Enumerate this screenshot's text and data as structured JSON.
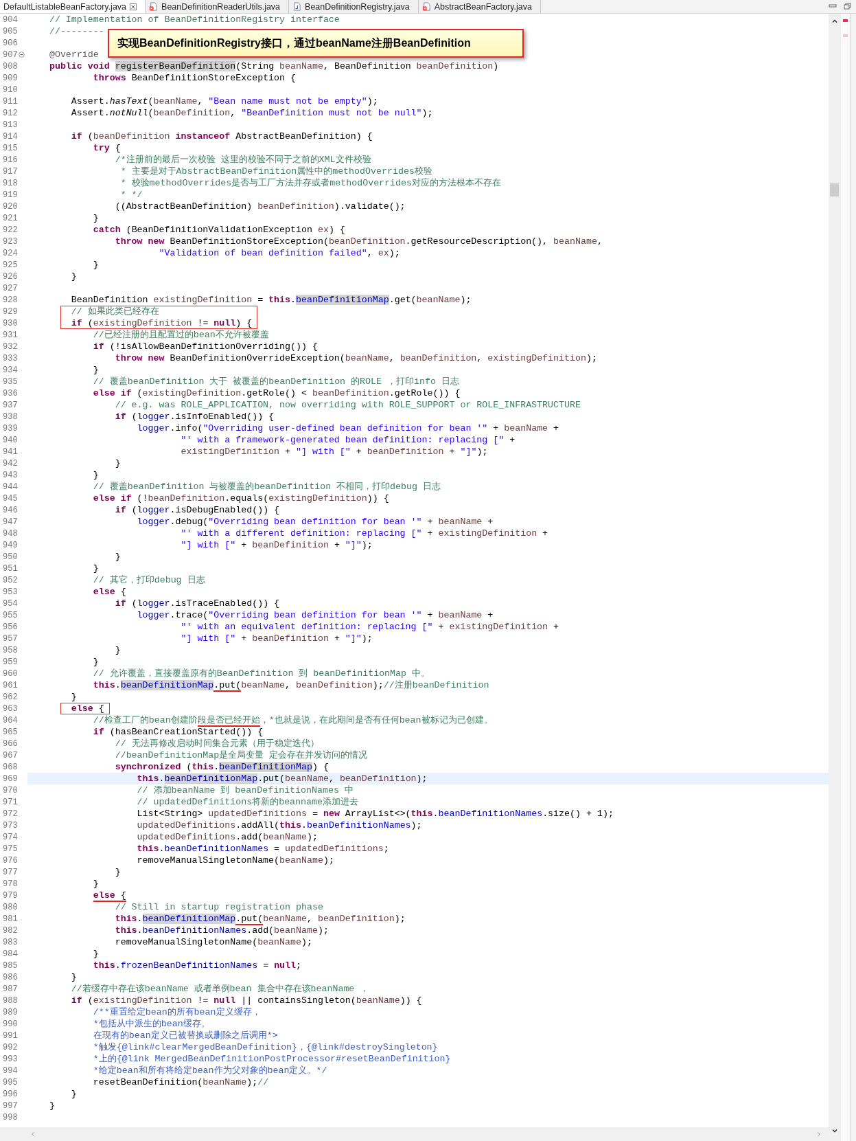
{
  "tabs": [
    {
      "label": "DefaultListableBeanFactory.java",
      "selected": true,
      "kind": "plain"
    },
    {
      "label": "BeanDefinitionReaderUtils.java",
      "selected": false,
      "kind": "error-file"
    },
    {
      "label": "BeanDefinitionRegistry.java",
      "selected": false,
      "kind": "java-file"
    },
    {
      "label": "AbstractBeanFactory.java",
      "selected": false,
      "kind": "error-file"
    }
  ],
  "callout": {
    "text": "实现BeanDefinitionRegistry接口，通过beanName注册BeanDefinition"
  },
  "lines": [
    {
      "number": "904",
      "code": [
        {
          "kind": "comment",
          "text": "    // Implementation of BeanDefinitionRegistry interface"
        }
      ]
    },
    {
      "number": "905",
      "code": [
        {
          "kind": "comment",
          "text": "    //--------"
        }
      ]
    },
    {
      "number": "906"
    },
    {
      "number": "907",
      "foldable": true,
      "code": [
        {
          "kind": "annotation",
          "text": "    @Override"
        }
      ]
    },
    {
      "number": "908",
      "code": [
        {
          "kind": "keyword",
          "text": "    public void "
        },
        {
          "kind": "method",
          "text": "registerBeanDefinition"
        },
        {
          "kind": "plain",
          "text": "(String "
        },
        {
          "kind": "local",
          "text": "beanName"
        },
        {
          "kind": "plain",
          "text": ", BeanDefinition "
        },
        {
          "kind": "local",
          "text": "beanDefinition"
        },
        {
          "kind": "plain",
          "text": ")"
        }
      ]
    },
    {
      "number": "909",
      "code": [
        {
          "kind": "keyword",
          "text": "            throws "
        },
        {
          "kind": "plain",
          "text": "BeanDefinitionStoreException {"
        }
      ]
    },
    {
      "number": "910"
    },
    {
      "number": "911",
      "code": [
        {
          "kind": "plain",
          "text": "        Assert."
        },
        {
          "kind": "italic",
          "text": "hasText"
        },
        {
          "kind": "plain",
          "text": "("
        },
        {
          "kind": "local",
          "text": "beanName"
        },
        {
          "kind": "plain",
          "text": ", "
        },
        {
          "kind": "string",
          "text": "\"Bean name must not be empty\""
        },
        {
          "kind": "plain",
          "text": ");"
        }
      ]
    },
    {
      "number": "912",
      "code": [
        {
          "kind": "plain",
          "text": "        Assert."
        },
        {
          "kind": "italic",
          "text": "notNull"
        },
        {
          "kind": "plain",
          "text": "("
        },
        {
          "kind": "local",
          "text": "beanDefinition"
        },
        {
          "kind": "plain",
          "text": ", "
        },
        {
          "kind": "string",
          "text": "\"BeanDefinition must not be null\""
        },
        {
          "kind": "plain",
          "text": ");"
        }
      ]
    },
    {
      "number": "913"
    },
    {
      "number": "914",
      "code": [
        {
          "kind": "keyword",
          "text": "        if "
        },
        {
          "kind": "plain",
          "text": "("
        },
        {
          "kind": "local",
          "text": "beanDefinition"
        },
        {
          "kind": "keyword",
          "text": " instanceof "
        },
        {
          "kind": "plain",
          "text": "AbstractBeanDefinition) {"
        }
      ]
    },
    {
      "number": "915",
      "code": [
        {
          "kind": "keyword",
          "text": "            try "
        },
        {
          "kind": "plain",
          "text": "{"
        }
      ]
    },
    {
      "number": "916",
      "code": [
        {
          "kind": "comment",
          "text": "                /*注册前的最后一次校验 这里的校验不同于之前的XML文件校验"
        }
      ]
    },
    {
      "number": "917",
      "code": [
        {
          "kind": "comment",
          "text": "                 * 主要是对于AbstractBeanDefinition属性中的methodOverrides校验"
        }
      ]
    },
    {
      "number": "918",
      "code": [
        {
          "kind": "comment",
          "text": "                 * 校验methodOverrides是否与工厂方法并存或者methodOverrides对应的方法根本不存在"
        }
      ]
    },
    {
      "number": "919",
      "code": [
        {
          "kind": "comment",
          "text": "                 * */"
        }
      ]
    },
    {
      "number": "920",
      "code": [
        {
          "kind": "plain",
          "text": "                ((AbstractBeanDefinition) "
        },
        {
          "kind": "local",
          "text": "beanDefinition"
        },
        {
          "kind": "plain",
          "text": ").validate();"
        }
      ]
    },
    {
      "number": "921",
      "code": [
        {
          "kind": "plain",
          "text": "            }"
        }
      ]
    },
    {
      "number": "922",
      "code": [
        {
          "kind": "keyword",
          "text": "            catch "
        },
        {
          "kind": "plain",
          "text": "(BeanDefinitionValidationException "
        },
        {
          "kind": "local",
          "text": "ex"
        },
        {
          "kind": "plain",
          "text": ") {"
        }
      ]
    },
    {
      "number": "923",
      "code": [
        {
          "kind": "keyword",
          "text": "                throw new "
        },
        {
          "kind": "plain",
          "text": "BeanDefinitionStoreException("
        },
        {
          "kind": "local",
          "text": "beanDefinition"
        },
        {
          "kind": "plain",
          "text": ".getResourceDescription(), "
        },
        {
          "kind": "local",
          "text": "beanName"
        },
        {
          "kind": "plain",
          "text": ","
        }
      ]
    },
    {
      "number": "924",
      "code": [
        {
          "kind": "string",
          "text": "                        \"Validation of bean definition failed\""
        },
        {
          "kind": "plain",
          "text": ", "
        },
        {
          "kind": "local",
          "text": "ex"
        },
        {
          "kind": "plain",
          "text": ");"
        }
      ]
    },
    {
      "number": "925",
      "code": [
        {
          "kind": "plain",
          "text": "            }"
        }
      ]
    },
    {
      "number": "926",
      "code": [
        {
          "kind": "plain",
          "text": "        }"
        }
      ]
    },
    {
      "number": "927"
    },
    {
      "number": "928",
      "code": [
        {
          "kind": "plain",
          "text": "        BeanDefinition "
        },
        {
          "kind": "local",
          "text": "existingDefinition"
        },
        {
          "kind": "plain",
          "text": " = "
        },
        {
          "kind": "keyword",
          "text": "this"
        },
        {
          "kind": "plain",
          "text": "."
        },
        {
          "kind": "marked-field",
          "text": "beanDefinitionMap"
        },
        {
          "kind": "plain",
          "text": ".get("
        },
        {
          "kind": "local",
          "text": "beanName"
        },
        {
          "kind": "plain",
          "text": ");"
        }
      ]
    },
    {
      "number": "929",
      "boxed": true,
      "code": [
        {
          "kind": "comment",
          "text": "        // 如果此类已经存在"
        }
      ]
    },
    {
      "number": "930",
      "boxed": true,
      "code": [
        {
          "kind": "keyword",
          "text": "        if "
        },
        {
          "kind": "plain",
          "text": "("
        },
        {
          "kind": "local",
          "text": "existingDefinition"
        },
        {
          "kind": "plain",
          "text": " != "
        },
        {
          "kind": "keyword",
          "text": "null"
        },
        {
          "kind": "plain",
          "text": ") {"
        }
      ]
    },
    {
      "number": "931",
      "code": [
        {
          "kind": "comment",
          "text": "            //已经注册的且配置过的bean不允许被覆盖"
        }
      ]
    },
    {
      "number": "932",
      "code": [
        {
          "kind": "keyword",
          "text": "            if "
        },
        {
          "kind": "plain",
          "text": "(!isAllowBeanDefinitionOverriding()) {"
        }
      ]
    },
    {
      "number": "933",
      "code": [
        {
          "kind": "keyword",
          "text": "                throw new "
        },
        {
          "kind": "plain",
          "text": "BeanDefinitionOverrideException("
        },
        {
          "kind": "local",
          "text": "beanName"
        },
        {
          "kind": "plain",
          "text": ", "
        },
        {
          "kind": "local",
          "text": "beanDefinition"
        },
        {
          "kind": "plain",
          "text": ", "
        },
        {
          "kind": "local",
          "text": "existingDefinition"
        },
        {
          "kind": "plain",
          "text": ");"
        }
      ]
    },
    {
      "number": "934",
      "code": [
        {
          "kind": "plain",
          "text": "            }"
        }
      ]
    },
    {
      "number": "935",
      "code": [
        {
          "kind": "comment",
          "text": "            // 覆盖beanDefinition 大于 被覆盖的beanDefinition 的ROLE ，打印info 日志"
        }
      ]
    },
    {
      "number": "936",
      "code": [
        {
          "kind": "keyword",
          "text": "            else if "
        },
        {
          "kind": "plain",
          "text": "("
        },
        {
          "kind": "local",
          "text": "existingDefinition"
        },
        {
          "kind": "plain",
          "text": ".getRole() < "
        },
        {
          "kind": "local",
          "text": "beanDefinition"
        },
        {
          "kind": "plain",
          "text": ".getRole()) {"
        }
      ]
    },
    {
      "number": "937",
      "code": [
        {
          "kind": "comment",
          "text": "                // e.g. was ROLE_APPLICATION, now overriding with ROLE_SUPPORT or ROLE_INFRASTRUCTURE"
        }
      ]
    },
    {
      "number": "938",
      "code": [
        {
          "kind": "keyword",
          "text": "                if "
        },
        {
          "kind": "plain",
          "text": "("
        },
        {
          "kind": "field",
          "text": "logger"
        },
        {
          "kind": "plain",
          "text": ".isInfoEnabled()) {"
        }
      ]
    },
    {
      "number": "939",
      "code": [
        {
          "kind": "field",
          "text": "                    logger"
        },
        {
          "kind": "plain",
          "text": ".info("
        },
        {
          "kind": "string",
          "text": "\"Overriding user-defined bean definition for bean '\""
        },
        {
          "kind": "plain",
          "text": " + "
        },
        {
          "kind": "local",
          "text": "beanName"
        },
        {
          "kind": "plain",
          "text": " +"
        }
      ]
    },
    {
      "number": "940",
      "code": [
        {
          "kind": "string",
          "text": "                            \"' with a framework-generated bean definition: replacing [\""
        },
        {
          "kind": "plain",
          "text": " +"
        }
      ]
    },
    {
      "number": "941",
      "code": [
        {
          "kind": "local",
          "text": "                            existingDefinition"
        },
        {
          "kind": "plain",
          "text": " + "
        },
        {
          "kind": "string",
          "text": "\"] with [\""
        },
        {
          "kind": "plain",
          "text": " + "
        },
        {
          "kind": "local",
          "text": "beanDefinition"
        },
        {
          "kind": "plain",
          "text": " + "
        },
        {
          "kind": "string",
          "text": "\"]\""
        },
        {
          "kind": "plain",
          "text": ");"
        }
      ]
    },
    {
      "number": "942",
      "code": [
        {
          "kind": "plain",
          "text": "                }"
        }
      ]
    },
    {
      "number": "943",
      "code": [
        {
          "kind": "plain",
          "text": "            }"
        }
      ]
    },
    {
      "number": "944",
      "code": [
        {
          "kind": "comment",
          "text": "            // 覆盖beanDefinition 与被覆盖的beanDefinition 不相同，打印debug 日志"
        }
      ]
    },
    {
      "number": "945",
      "code": [
        {
          "kind": "keyword",
          "text": "            else if "
        },
        {
          "kind": "plain",
          "text": "(!"
        },
        {
          "kind": "local",
          "text": "beanDefinition"
        },
        {
          "kind": "plain",
          "text": ".equals("
        },
        {
          "kind": "local",
          "text": "existingDefinition"
        },
        {
          "kind": "plain",
          "text": ")) {"
        }
      ]
    },
    {
      "number": "946",
      "code": [
        {
          "kind": "keyword",
          "text": "                if "
        },
        {
          "kind": "plain",
          "text": "("
        },
        {
          "kind": "field",
          "text": "logger"
        },
        {
          "kind": "plain",
          "text": ".isDebugEnabled()) {"
        }
      ]
    },
    {
      "number": "947",
      "code": [
        {
          "kind": "field",
          "text": "                    logger"
        },
        {
          "kind": "plain",
          "text": ".debug("
        },
        {
          "kind": "string",
          "text": "\"Overriding bean definition for bean '\""
        },
        {
          "kind": "plain",
          "text": " + "
        },
        {
          "kind": "local",
          "text": "beanName"
        },
        {
          "kind": "plain",
          "text": " +"
        }
      ]
    },
    {
      "number": "948",
      "code": [
        {
          "kind": "string",
          "text": "                            \"' with a different definition: replacing [\""
        },
        {
          "kind": "plain",
          "text": " + "
        },
        {
          "kind": "local",
          "text": "existingDefinition"
        },
        {
          "kind": "plain",
          "text": " +"
        }
      ]
    },
    {
      "number": "949",
      "code": [
        {
          "kind": "string",
          "text": "                            \"] with [\""
        },
        {
          "kind": "plain",
          "text": " + "
        },
        {
          "kind": "local",
          "text": "beanDefinition"
        },
        {
          "kind": "plain",
          "text": " + "
        },
        {
          "kind": "string",
          "text": "\"]\""
        },
        {
          "kind": "plain",
          "text": ");"
        }
      ]
    },
    {
      "number": "950",
      "code": [
        {
          "kind": "plain",
          "text": "                }"
        }
      ]
    },
    {
      "number": "951",
      "code": [
        {
          "kind": "plain",
          "text": "            }"
        }
      ]
    },
    {
      "number": "952",
      "code": [
        {
          "kind": "comment",
          "text": "            // 其它，打印debug 日志"
        }
      ]
    },
    {
      "number": "953",
      "code": [
        {
          "kind": "keyword",
          "text": "            else "
        },
        {
          "kind": "plain",
          "text": "{"
        }
      ]
    },
    {
      "number": "954",
      "code": [
        {
          "kind": "keyword",
          "text": "                if "
        },
        {
          "kind": "plain",
          "text": "("
        },
        {
          "kind": "field",
          "text": "logger"
        },
        {
          "kind": "plain",
          "text": ".isTraceEnabled()) {"
        }
      ]
    },
    {
      "number": "955",
      "code": [
        {
          "kind": "field",
          "text": "                    logger"
        },
        {
          "kind": "plain",
          "text": ".trace("
        },
        {
          "kind": "string",
          "text": "\"Overriding bean definition for bean '\""
        },
        {
          "kind": "plain",
          "text": " + "
        },
        {
          "kind": "local",
          "text": "beanName"
        },
        {
          "kind": "plain",
          "text": " +"
        }
      ]
    },
    {
      "number": "956",
      "code": [
        {
          "kind": "string",
          "text": "                            \"' with an equivalent definition: replacing [\""
        },
        {
          "kind": "plain",
          "text": " + "
        },
        {
          "kind": "local",
          "text": "existingDefinition"
        },
        {
          "kind": "plain",
          "text": " +"
        }
      ]
    },
    {
      "number": "957",
      "code": [
        {
          "kind": "string",
          "text": "                            \"] with [\""
        },
        {
          "kind": "plain",
          "text": " + "
        },
        {
          "kind": "local",
          "text": "beanDefinition"
        },
        {
          "kind": "plain",
          "text": " + "
        },
        {
          "kind": "string",
          "text": "\"]\""
        },
        {
          "kind": "plain",
          "text": ");"
        }
      ]
    },
    {
      "number": "958",
      "code": [
        {
          "kind": "plain",
          "text": "                }"
        }
      ]
    },
    {
      "number": "959",
      "code": [
        {
          "kind": "plain",
          "text": "            }"
        }
      ]
    },
    {
      "number": "960",
      "code": [
        {
          "kind": "comment",
          "text": "            // 允许覆盖，直接覆盖原有的BeanDefinition 到 beanDefinitionMap 中。"
        }
      ]
    },
    {
      "number": "961",
      "code": [
        {
          "kind": "keyword",
          "text": "            this"
        },
        {
          "kind": "plain",
          "text": "."
        },
        {
          "kind": "marked-field",
          "text": "beanDefinitionMap"
        },
        {
          "kind": "plain",
          "text": ".put(",
          "underline": true
        },
        {
          "kind": "local",
          "text": "beanName"
        },
        {
          "kind": "plain",
          "text": ", "
        },
        {
          "kind": "local",
          "text": "beanDefinition"
        },
        {
          "kind": "plain",
          "text": ");"
        },
        {
          "kind": "comment",
          "text": "//注册beanDefinition"
        }
      ]
    },
    {
      "number": "962",
      "code": [
        {
          "kind": "plain",
          "text": "        }"
        }
      ]
    },
    {
      "number": "963",
      "boxed": true,
      "code": [
        {
          "kind": "keyword",
          "text": "        else "
        },
        {
          "kind": "plain",
          "text": "{"
        }
      ]
    },
    {
      "number": "964",
      "code": [
        {
          "kind": "comment",
          "text": "            //检查工厂的bean创建阶"
        },
        {
          "kind": "comment",
          "text": "段是否已经开始",
          "underline": true
        },
        {
          "kind": "comment",
          "text": "，*也就是说，在此期间是否有任何bean被标记为已创建。"
        }
      ]
    },
    {
      "number": "965",
      "code": [
        {
          "kind": "keyword",
          "text": "            if "
        },
        {
          "kind": "plain",
          "text": "(hasBeanCreationStarted()) {"
        }
      ]
    },
    {
      "number": "966",
      "code": [
        {
          "kind": "comment",
          "text": "                // 无法再修改启动时间集合元素（用于稳定迭代）"
        }
      ]
    },
    {
      "number": "967",
      "code": [
        {
          "kind": "comment",
          "text": "                //beanDefinitionMap是全局变量 定会存在并发访问的情况"
        }
      ]
    },
    {
      "number": "968",
      "code": [
        {
          "kind": "keyword",
          "text": "                synchronized "
        },
        {
          "kind": "plain",
          "text": "("
        },
        {
          "kind": "keyword",
          "text": "this"
        },
        {
          "kind": "plain",
          "text": "."
        },
        {
          "kind": "marked-field",
          "text": "beanDefinitionMap"
        },
        {
          "kind": "plain",
          "text": ") {"
        }
      ]
    },
    {
      "number": "969",
      "current": true,
      "code": [
        {
          "kind": "keyword",
          "text": "                    this"
        },
        {
          "kind": "plain",
          "text": "."
        },
        {
          "kind": "marked-field",
          "text": "beanDefinitionMap"
        },
        {
          "kind": "plain",
          "text": ".put("
        },
        {
          "kind": "local",
          "text": "beanName"
        },
        {
          "kind": "plain",
          "text": ", "
        },
        {
          "kind": "local",
          "text": "beanDefinition"
        },
        {
          "kind": "plain",
          "text": ");"
        }
      ]
    },
    {
      "number": "970",
      "code": [
        {
          "kind": "comment",
          "text": "                    // 添加beanName 到 beanDefinitionNames 中"
        }
      ]
    },
    {
      "number": "971",
      "code": [
        {
          "kind": "comment",
          "text": "                    // updatedDefinitions将新的beanname添加进去"
        }
      ]
    },
    {
      "number": "972",
      "code": [
        {
          "kind": "plain",
          "text": "                    List<String> "
        },
        {
          "kind": "local",
          "text": "updatedDefinitions"
        },
        {
          "kind": "plain",
          "text": " = "
        },
        {
          "kind": "keyword",
          "text": "new "
        },
        {
          "kind": "plain",
          "text": "ArrayList<>("
        },
        {
          "kind": "keyword",
          "text": "this"
        },
        {
          "kind": "plain",
          "text": "."
        },
        {
          "kind": "field",
          "text": "beanDefinitionNames"
        },
        {
          "kind": "plain",
          "text": ".size() + 1);"
        }
      ]
    },
    {
      "number": "973",
      "code": [
        {
          "kind": "local",
          "text": "                    updatedDefinitions"
        },
        {
          "kind": "plain",
          "text": ".addAll("
        },
        {
          "kind": "keyword",
          "text": "this"
        },
        {
          "kind": "plain",
          "text": "."
        },
        {
          "kind": "field",
          "text": "beanDefinitionNames"
        },
        {
          "kind": "plain",
          "text": ");"
        }
      ]
    },
    {
      "number": "974",
      "code": [
        {
          "kind": "local",
          "text": "                    updatedDefinitions"
        },
        {
          "kind": "plain",
          "text": ".add("
        },
        {
          "kind": "local",
          "text": "beanName"
        },
        {
          "kind": "plain",
          "text": ");"
        }
      ]
    },
    {
      "number": "975",
      "code": [
        {
          "kind": "keyword",
          "text": "                    this"
        },
        {
          "kind": "plain",
          "text": "."
        },
        {
          "kind": "field",
          "text": "beanDefinitionNames"
        },
        {
          "kind": "plain",
          "text": " = "
        },
        {
          "kind": "local",
          "text": "updatedDefinitions"
        },
        {
          "kind": "plain",
          "text": ";"
        }
      ]
    },
    {
      "number": "976",
      "code": [
        {
          "kind": "plain",
          "text": "                    removeManualSingletonName("
        },
        {
          "kind": "local",
          "text": "beanName"
        },
        {
          "kind": "plain",
          "text": ");"
        }
      ]
    },
    {
      "number": "977",
      "code": [
        {
          "kind": "plain",
          "text": "                }"
        }
      ]
    },
    {
      "number": "978",
      "code": [
        {
          "kind": "plain",
          "text": "            }"
        }
      ]
    },
    {
      "number": "979",
      "code": [
        {
          "kind": "keyword",
          "text": "            else ",
          "underline": true
        },
        {
          "kind": "plain",
          "text": "{",
          "underline": true
        }
      ]
    },
    {
      "number": "980",
      "code": [
        {
          "kind": "comment",
          "text": "                // Still in startup registration phase"
        }
      ]
    },
    {
      "number": "981",
      "code": [
        {
          "kind": "keyword",
          "text": "                this"
        },
        {
          "kind": "plain",
          "text": "."
        },
        {
          "kind": "marked-field",
          "text": "beanDefinitionMap"
        },
        {
          "kind": "plain",
          "text": ".put(",
          "underline": true
        },
        {
          "kind": "local",
          "text": "beanName"
        },
        {
          "kind": "plain",
          "text": ", "
        },
        {
          "kind": "local",
          "text": "beanDefinition"
        },
        {
          "kind": "plain",
          "text": ");"
        }
      ]
    },
    {
      "number": "982",
      "code": [
        {
          "kind": "keyword",
          "text": "                this"
        },
        {
          "kind": "plain",
          "text": "."
        },
        {
          "kind": "field",
          "text": "beanDefinitionNames"
        },
        {
          "kind": "plain",
          "text": ".add("
        },
        {
          "kind": "local",
          "text": "beanName"
        },
        {
          "kind": "plain",
          "text": ");"
        }
      ]
    },
    {
      "number": "983",
      "code": [
        {
          "kind": "plain",
          "text": "                removeManualSingletonName("
        },
        {
          "kind": "local",
          "text": "beanName"
        },
        {
          "kind": "plain",
          "text": ");"
        }
      ]
    },
    {
      "number": "984",
      "code": [
        {
          "kind": "plain",
          "text": "            }"
        }
      ]
    },
    {
      "number": "985",
      "code": [
        {
          "kind": "keyword",
          "text": "            this"
        },
        {
          "kind": "plain",
          "text": "."
        },
        {
          "kind": "field",
          "text": "frozenBeanDefinitionNames"
        },
        {
          "kind": "plain",
          "text": " = "
        },
        {
          "kind": "keyword",
          "text": "null"
        },
        {
          "kind": "plain",
          "text": ";"
        }
      ]
    },
    {
      "number": "986",
      "code": [
        {
          "kind": "plain",
          "text": "        }"
        }
      ]
    },
    {
      "number": "987",
      "code": [
        {
          "kind": "comment",
          "text": "        //若缓存中存在该beanName 或者单例bean 集合中存在该beanName ，"
        }
      ]
    },
    {
      "number": "988",
      "code": [
        {
          "kind": "keyword",
          "text": "        if "
        },
        {
          "kind": "plain",
          "text": "("
        },
        {
          "kind": "local",
          "text": "existingDefinition"
        },
        {
          "kind": "plain",
          "text": " != "
        },
        {
          "kind": "keyword",
          "text": "null"
        },
        {
          "kind": "plain",
          "text": " || containsSingleton("
        },
        {
          "kind": "local",
          "text": "beanName"
        },
        {
          "kind": "plain",
          "text": ")) {"
        }
      ]
    },
    {
      "number": "989",
      "code": [
        {
          "kind": "javadoc",
          "text": "            /**重置给定bean的所有bean定义缓存，"
        }
      ]
    },
    {
      "number": "990",
      "code": [
        {
          "kind": "javadoc",
          "text": "            *包括从中派生的bean缓存。"
        }
      ]
    },
    {
      "number": "991",
      "code": [
        {
          "kind": "javadoc",
          "text": "            在现有的bean定义已被替换或删除之后调用*>"
        }
      ]
    },
    {
      "number": "992",
      "code": [
        {
          "kind": "javadoc",
          "text": "            *触发{@link#clearMergedBeanDefinition}，{@link#destroySingleton}"
        }
      ]
    },
    {
      "number": "993",
      "code": [
        {
          "kind": "javadoc",
          "text": "            *上的{@link MergedBeanDefinitionPostProcessor#resetBeanDefinition}"
        }
      ]
    },
    {
      "number": "994",
      "code": [
        {
          "kind": "javadoc",
          "text": "            *给定bean和所有将给定bean作为父对象的bean定义。*/"
        }
      ]
    },
    {
      "number": "995",
      "code": [
        {
          "kind": "plain",
          "text": "            resetBeanDefinition("
        },
        {
          "kind": "local",
          "text": "beanName"
        },
        {
          "kind": "plain",
          "text": ");"
        },
        {
          "kind": "comment",
          "text": "//"
        }
      ]
    },
    {
      "number": "996",
      "code": [
        {
          "kind": "plain",
          "text": "        }"
        }
      ]
    },
    {
      "number": "997",
      "code": [
        {
          "kind": "plain",
          "text": "    }"
        }
      ]
    },
    {
      "number": "998"
    }
  ]
}
